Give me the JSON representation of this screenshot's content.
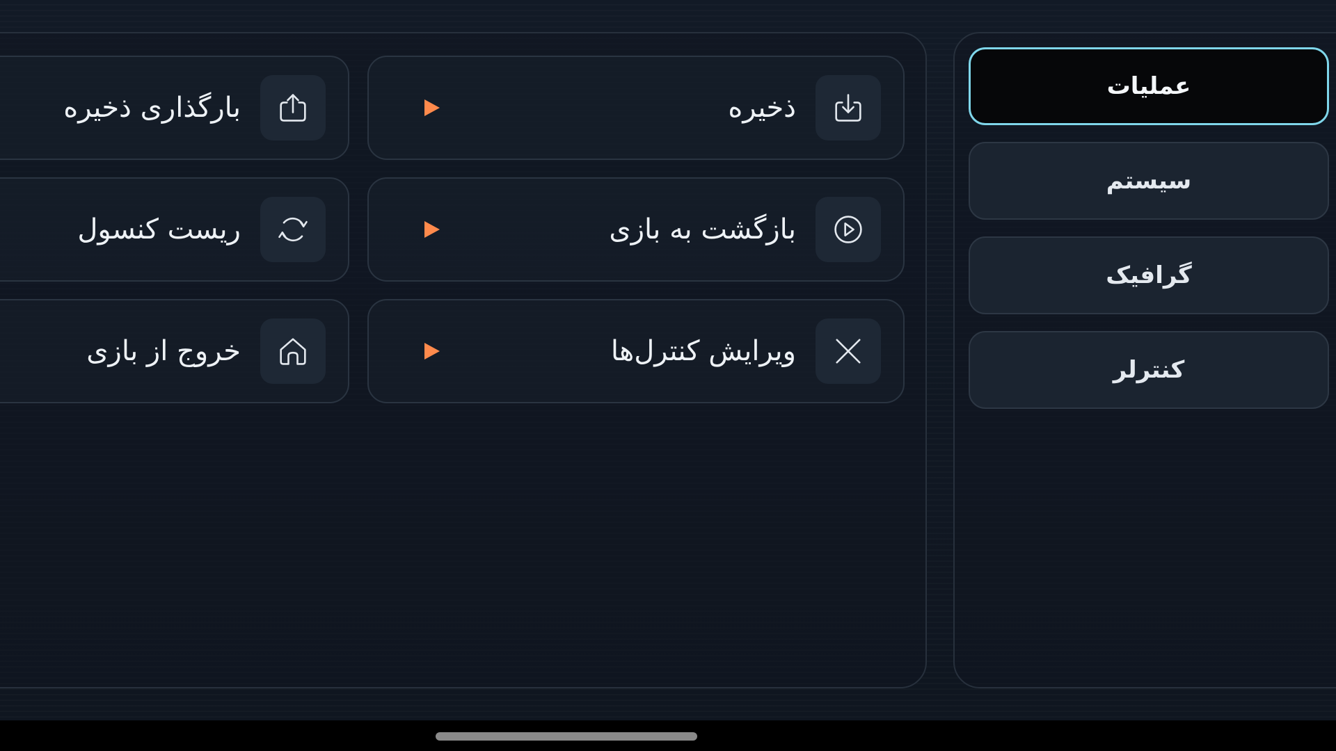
{
  "menu": {
    "items": [
      {
        "label": "ذخیره",
        "icon": "download-icon"
      },
      {
        "label": "بارگذاری ذخیره",
        "icon": "upload-icon"
      },
      {
        "label": "بازگشت به بازی",
        "icon": "play-circle-icon"
      },
      {
        "label": "ریست کنسول",
        "icon": "refresh-icon"
      },
      {
        "label": "ویرایش کنترل‌ها",
        "icon": "close-icon"
      },
      {
        "label": "خروج از بازی",
        "icon": "home-icon"
      }
    ]
  },
  "tabs": [
    {
      "label": "عملیات",
      "active": true
    },
    {
      "label": "سیستم",
      "active": false
    },
    {
      "label": "گرافیک",
      "active": false
    },
    {
      "label": "کنترلر",
      "active": false
    }
  ],
  "colors": {
    "accent_arrow": "#ff8a4c",
    "active_tab_border": "#7fd6ea",
    "background": "#121a26"
  }
}
